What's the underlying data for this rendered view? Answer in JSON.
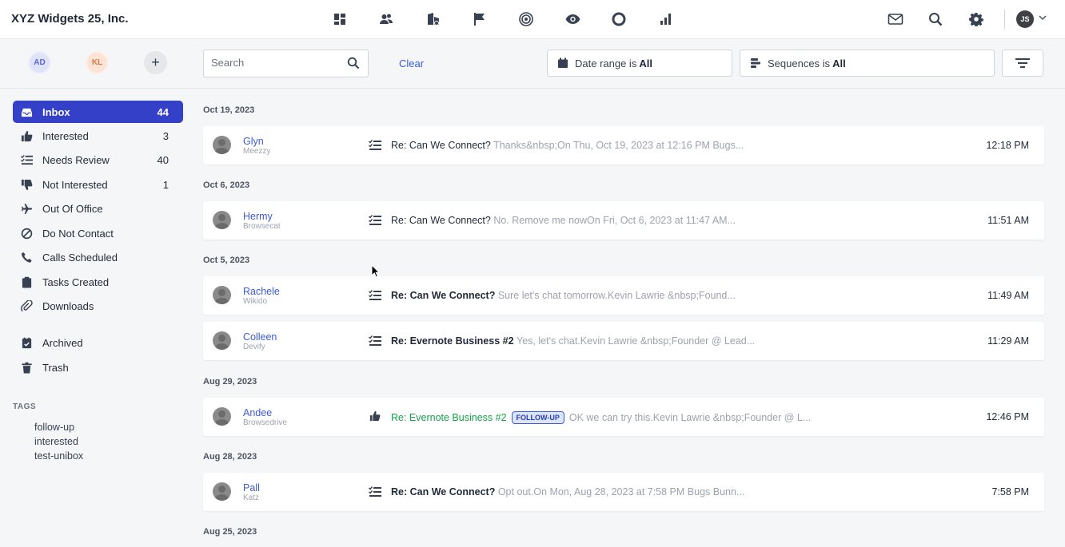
{
  "header": {
    "brand": "XYZ Widgets 25, Inc.",
    "user_initials": "JS"
  },
  "filters": {
    "accounts": [
      "AD",
      "KL"
    ],
    "add_label": "+",
    "search_placeholder": "Search",
    "clear_label": "Clear",
    "date_range_prefix": "Date range is",
    "date_range_value": "All",
    "sequences_prefix": "Sequences is",
    "sequences_value": "All"
  },
  "sidebar": {
    "items": [
      {
        "label": "Inbox",
        "count": "44",
        "icon": "inbox-icon"
      },
      {
        "label": "Interested",
        "count": "3",
        "icon": "thumbs-up-icon"
      },
      {
        "label": "Needs Review",
        "count": "40",
        "icon": "list-check-icon"
      },
      {
        "label": "Not Interested",
        "count": "1",
        "icon": "thumbs-down-icon"
      },
      {
        "label": "Out Of Office",
        "count": "",
        "icon": "plane-icon"
      },
      {
        "label": "Do Not Contact",
        "count": "",
        "icon": "ban-icon"
      },
      {
        "label": "Calls Scheduled",
        "count": "",
        "icon": "phone-icon"
      },
      {
        "label": "Tasks Created",
        "count": "",
        "icon": "clipboard-icon"
      },
      {
        "label": "Downloads",
        "count": "",
        "icon": "paperclip-icon"
      },
      {
        "label": "Archived",
        "count": "",
        "icon": "archive-icon"
      },
      {
        "label": "Trash",
        "count": "",
        "icon": "trash-icon"
      }
    ],
    "tags_title": "TAGS",
    "tags": [
      "follow-up",
      "interested",
      "test-unibox"
    ]
  },
  "messages": {
    "dates": [
      "Oct 19, 2023",
      "Oct 6, 2023",
      "Oct 5, 2023",
      "Aug 29, 2023",
      "Aug 28, 2023",
      "Aug 25, 2023"
    ],
    "rows": [
      {
        "name": "Glyn",
        "company": "Meezzy",
        "subject": "Re: Can We Connect?",
        "preview": "Thanks&nbsp;On Thu, Oct 19, 2023 at 12:16 PM Bugs...",
        "time": "12:18 PM",
        "status": "read"
      },
      {
        "name": "Hermy",
        "company": "Browsecat",
        "subject": "Re: Can We Connect?",
        "preview": "No. Remove me nowOn Fri, Oct 6, 2023 at 11:47 AM...",
        "time": "11:51 AM",
        "status": "read"
      },
      {
        "name": "Rachele",
        "company": "Wikido",
        "subject": "Re: Can We Connect?",
        "preview": "Sure let's chat tomorrow.Kevin Lawrie &nbsp;Found...",
        "time": "11:49 AM",
        "status": "unread"
      },
      {
        "name": "Colleen",
        "company": "Devify",
        "subject": "Re: Evernote Business #2",
        "preview": "Yes, let's chat.Kevin Lawrie &nbsp;Founder @ Lead...",
        "time": "11:29 AM",
        "status": "unread"
      },
      {
        "name": "Andee",
        "company": "Browsedrive",
        "subject": "Re: Evernote Business #2",
        "badge": "FOLLOW-UP",
        "preview": "OK we can try this.Kevin Lawrie &nbsp;Founder @ L...",
        "time": "12:46 PM",
        "status": "interested"
      },
      {
        "name": "Pall",
        "company": "Katz",
        "subject": "Re: Can We Connect?",
        "preview": "Opt out.On Mon, Aug 28, 2023 at 7:58 PM Bugs Bunn...",
        "time": "7:58 PM",
        "status": "unread"
      }
    ]
  },
  "colors": {
    "accent": "#3440c8",
    "link": "#3b5bdb",
    "interested": "#16a34a"
  }
}
